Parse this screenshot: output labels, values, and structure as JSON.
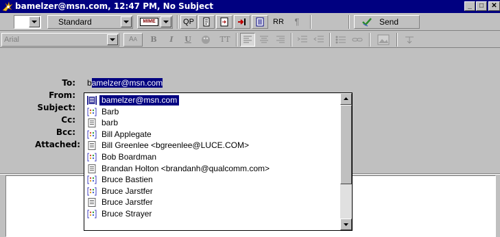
{
  "window": {
    "title": "bamelzer@msn.com, 12:47 PM, No Subject",
    "minimize_glyph": "_",
    "maximize_glyph": "□",
    "close_glyph": "✕"
  },
  "toolbar1": {
    "priority_value": "",
    "style_value": "Standard",
    "mime_label": "MIME",
    "qp_label": "QP",
    "rr_label": "RR",
    "pilcrow_label": "¶",
    "send_label": "Send"
  },
  "toolbar2": {
    "font_value": "Arial",
    "bold_label": "B",
    "italic_label": "I",
    "underline_label": "U",
    "tt_label": "TT"
  },
  "header": {
    "to_label": "To:",
    "from_label": "From:",
    "subject_label": "Subject:",
    "cc_label": "Cc:",
    "bcc_label": "Bcc:",
    "attached_label": "Attached:",
    "to_typed": "b",
    "to_completion": "amelzer@msn.com"
  },
  "autocomplete": {
    "items": [
      {
        "label": "bamelzer@msn.com",
        "icon": "address-card-icon",
        "selected": true
      },
      {
        "label": "Barb",
        "icon": "group-icon",
        "selected": false
      },
      {
        "label": "barb",
        "icon": "address-card-icon",
        "selected": false
      },
      {
        "label": "Bill Applegate",
        "icon": "group-icon",
        "selected": false
      },
      {
        "label": "Bill Greenlee <bgreenlee@LUCE.COM>",
        "icon": "address-card-icon",
        "selected": false
      },
      {
        "label": "Bob Boardman",
        "icon": "group-icon",
        "selected": false
      },
      {
        "label": "Brandan Holton <brandanh@qualcomm.com>",
        "icon": "address-card-icon",
        "selected": false
      },
      {
        "label": "Bruce Bastien",
        "icon": "group-icon",
        "selected": false
      },
      {
        "label": "Bruce Jarstfer",
        "icon": "group-icon",
        "selected": false
      },
      {
        "label": "Bruce Jarstfer",
        "icon": "address-card-icon",
        "selected": false
      },
      {
        "label": "Bruce Strayer",
        "icon": "group-icon",
        "selected": false
      }
    ]
  },
  "colors": {
    "titlebar": "#000080",
    "selection": "#000080",
    "face": "#c0c0c0"
  }
}
